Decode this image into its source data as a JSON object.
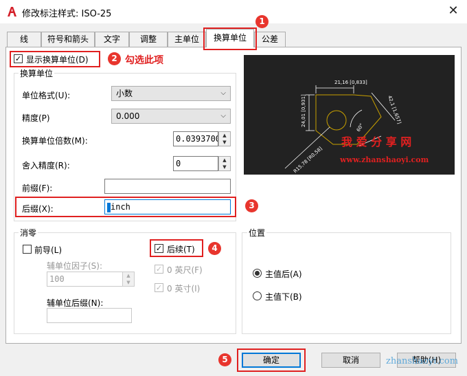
{
  "window": {
    "title": "修改标注样式: ISO-25",
    "close_glyph": "✕"
  },
  "tabs": [
    {
      "label": "线"
    },
    {
      "label": "符号和箭头"
    },
    {
      "label": "文字"
    },
    {
      "label": "调整"
    },
    {
      "label": "主单位"
    },
    {
      "label": "换算单位"
    },
    {
      "label": "公差"
    }
  ],
  "show_alt": {
    "label": "显示换算单位(D)",
    "checked": true
  },
  "alt_units": {
    "group_label": "换算单位",
    "unit_format": {
      "label": "单位格式(U):",
      "value": "小数"
    },
    "precision": {
      "label": "精度(P)",
      "value": "0.000"
    },
    "multiplier": {
      "label": "换算单位倍数(M):",
      "value": "0.0393700"
    },
    "round_off": {
      "label": "舍入精度(R):",
      "value": "0"
    },
    "prefix": {
      "label": "前缀(F):",
      "value": ""
    },
    "suffix": {
      "label": "后缀(X):",
      "value": "inch"
    }
  },
  "zero_suppression": {
    "group_label": "消零",
    "leading": {
      "label": "前导(L)",
      "checked": false
    },
    "sub_factor": {
      "label": "辅单位因子(S):",
      "value": "100"
    },
    "sub_suffix": {
      "label": "辅单位后缀(N):",
      "value": ""
    },
    "trailing": {
      "label": "后续(T)",
      "checked": true
    },
    "feet": {
      "label": "0 英尺(F)",
      "checked": true
    },
    "inches": {
      "label": "0 英寸(I)",
      "checked": true
    }
  },
  "placement": {
    "group_label": "位置",
    "after": {
      "label": "主值后(A)",
      "selected": true
    },
    "below": {
      "label": "主值下(B)",
      "selected": false
    }
  },
  "preview": {
    "dims": [
      "21,16 [0,833]",
      "24,01 [0,931]",
      "42,1 [1,657]",
      "60°",
      "R15,78 [R0,58]"
    ],
    "watermark_cn": "我 爱 分 享 网",
    "watermark_url": "www.zhanshaoyi.com"
  },
  "buttons": {
    "ok": "确定",
    "cancel": "取消",
    "help": "帮助(H)"
  },
  "annotations": {
    "n1": "1",
    "n2": "2",
    "n3": "3",
    "n4": "4",
    "n5": "5",
    "tip2": "勾选此项",
    "bottom_watermark": "zhanshaoyi.com"
  },
  "colors": {
    "annotation_red": "#e02020",
    "badge_red": "#e8352d",
    "preview_bg": "#222222",
    "preview_line": "#c8a000",
    "watermark_red": "#e02020"
  }
}
